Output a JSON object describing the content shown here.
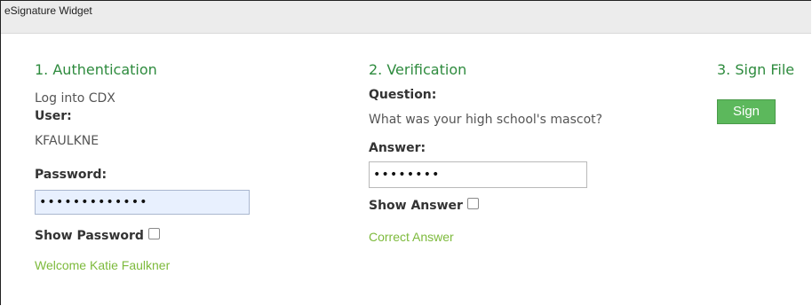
{
  "window": {
    "title": "eSignature Widget"
  },
  "authentication": {
    "heading": "1. Authentication",
    "subheading": "Log into CDX",
    "user_label": "User:",
    "user_value": "KFAULKNE",
    "password_label": "Password:",
    "password_value": "•••••••••••••",
    "show_password_label": "Show Password",
    "status": "Welcome Katie Faulkner"
  },
  "verification": {
    "heading": "2. Verification",
    "question_label": "Question:",
    "question_text": "What was your high school's mascot?",
    "answer_label": "Answer:",
    "answer_value": "••••••••",
    "show_answer_label": "Show Answer",
    "status": "Correct Answer"
  },
  "sign": {
    "heading": "3. Sign File",
    "button_label": "Sign"
  },
  "colors": {
    "heading": "#2e8b3e",
    "status": "#7dba3c",
    "button": "#5cb85c"
  }
}
